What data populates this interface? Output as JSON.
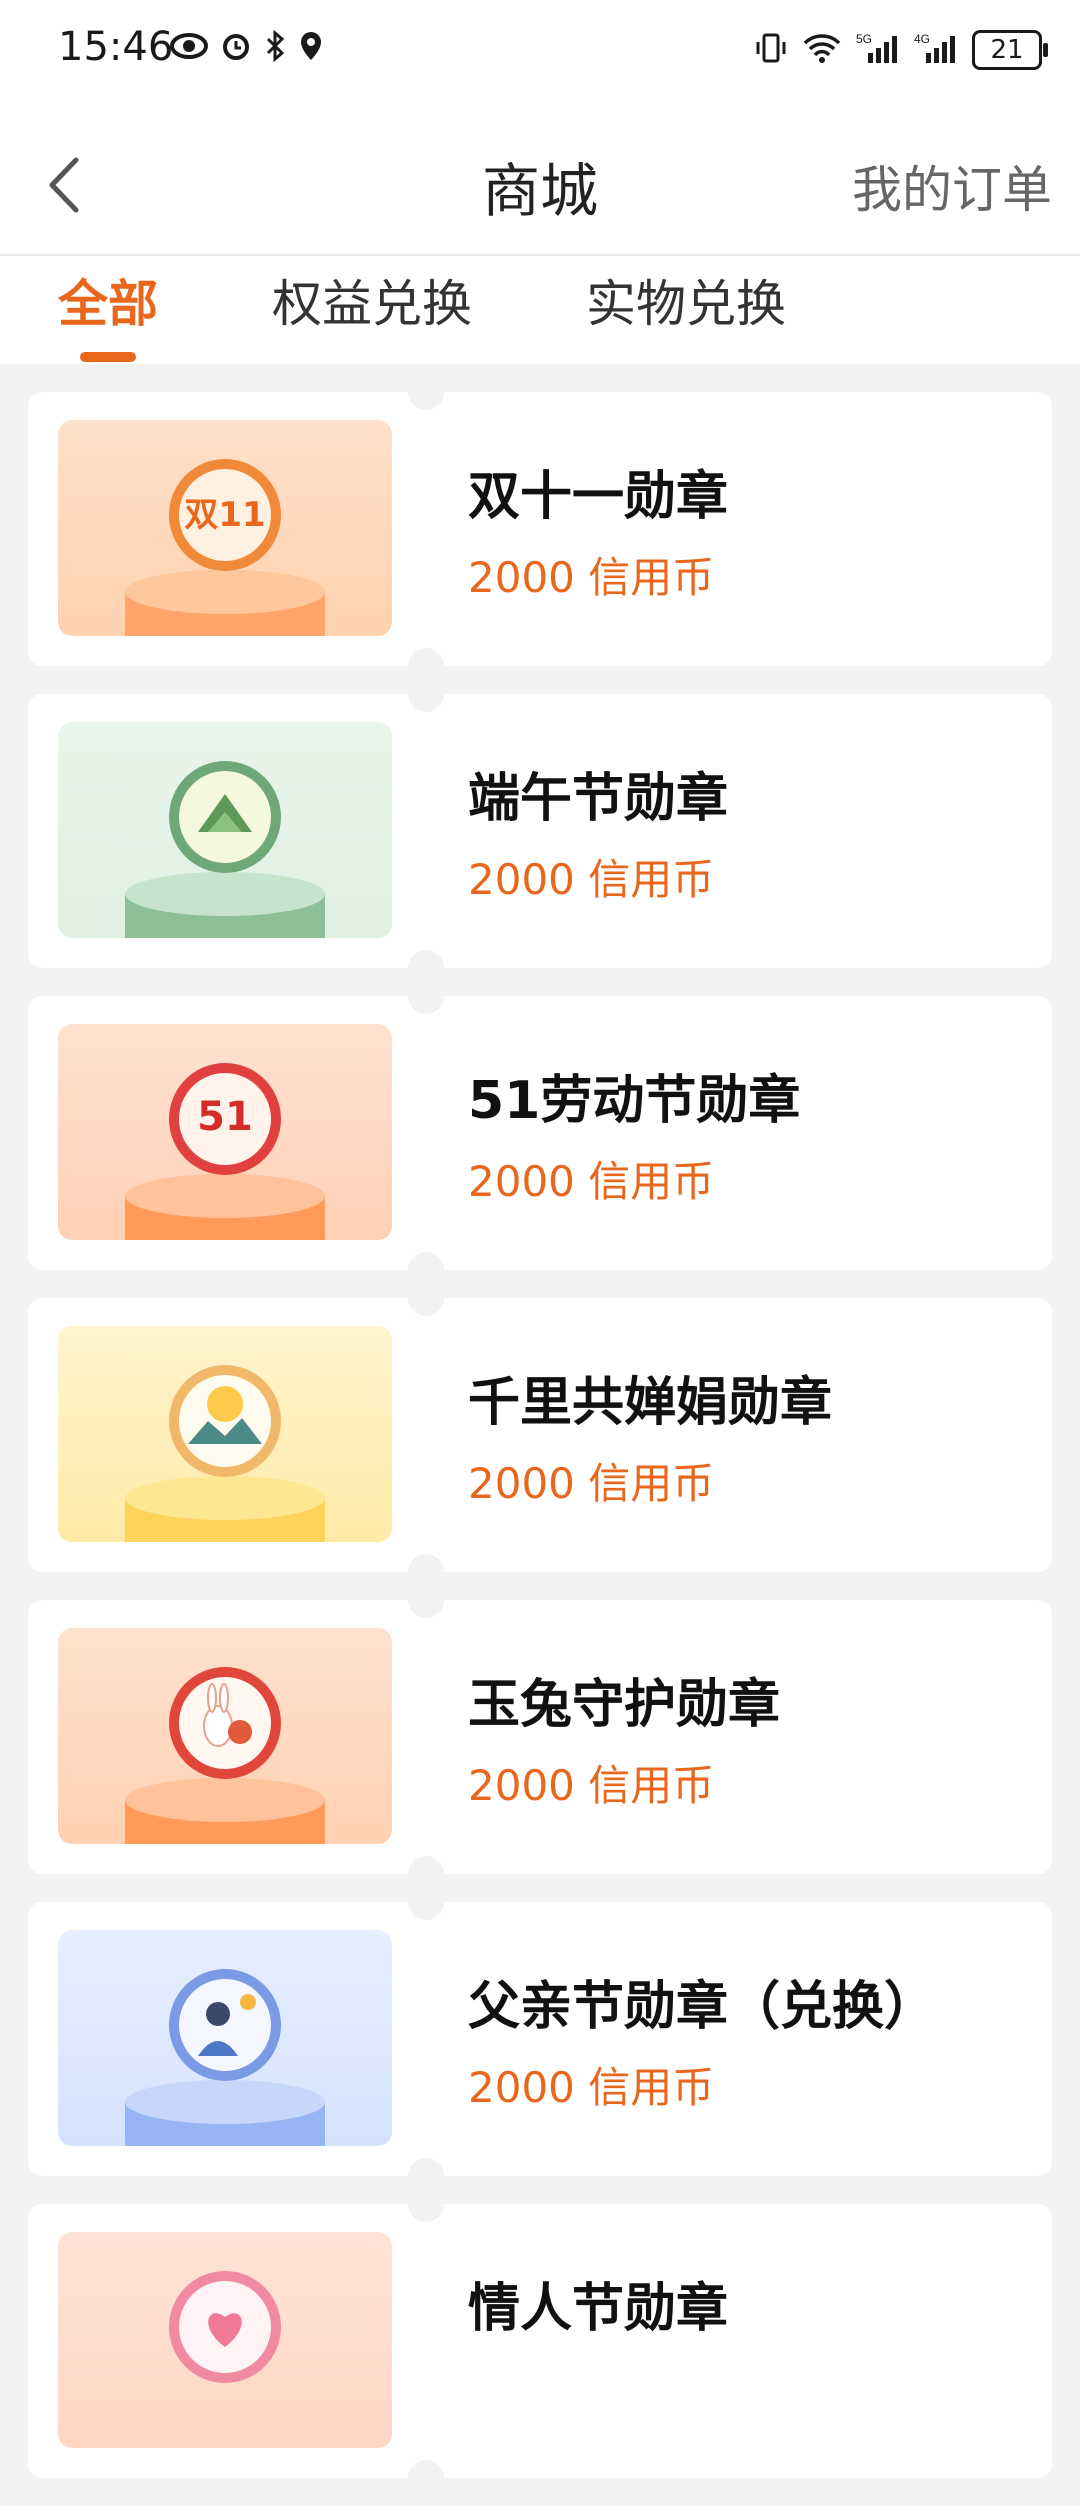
{
  "status_bar": {
    "time": "15:46",
    "battery": "21",
    "icons": [
      "eye-icon",
      "alarm-icon",
      "bluetooth-icon",
      "location-icon",
      "vibrate-icon",
      "wifi-icon",
      "5g-signal-icon",
      "4g-signal-icon",
      "battery-icon"
    ]
  },
  "header": {
    "title": "商城",
    "orders_label": "我的订单"
  },
  "tabs": [
    {
      "label": "全部",
      "active": true
    },
    {
      "label": "权益兑换",
      "active": false
    },
    {
      "label": "实物兑换",
      "active": false
    }
  ],
  "colors": {
    "accent": "#e8671c"
  },
  "items": [
    {
      "name": "双十一勋章",
      "price": "2000 信用币",
      "theme": "orange",
      "badge": "双11"
    },
    {
      "name": "端午节勋章",
      "price": "2000 信用币",
      "theme": "green",
      "badge": ""
    },
    {
      "name": "51劳动节勋章",
      "price": "2000 信用币",
      "theme": "red",
      "badge": "51"
    },
    {
      "name": "千里共婵娟勋章",
      "price": "2000 信用币",
      "theme": "yellow",
      "badge": ""
    },
    {
      "name": "玉兔守护勋章",
      "price": "2000 信用币",
      "theme": "orange",
      "badge": ""
    },
    {
      "name": "父亲节勋章（兑换）",
      "price": "2000 信用币",
      "theme": "blue",
      "badge": ""
    },
    {
      "name": "情人节勋章",
      "price": "",
      "theme": "pink",
      "badge": ""
    }
  ]
}
